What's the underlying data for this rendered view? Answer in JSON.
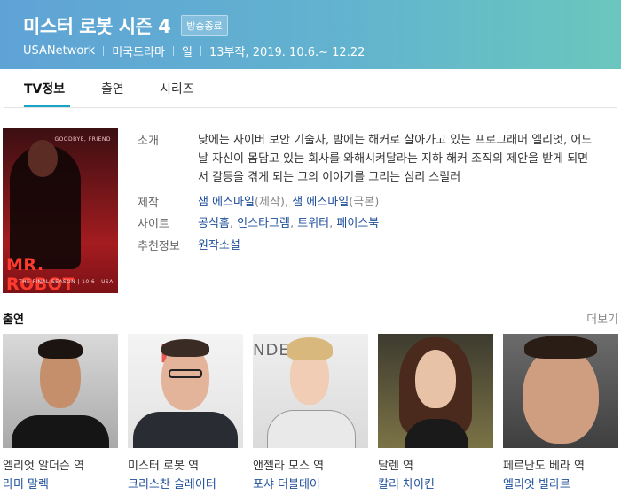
{
  "header": {
    "title": "미스터 로봇 시즌 4",
    "badge": "방송종료",
    "network": "USANetwork",
    "genre": "미국드라마",
    "day": "일",
    "episodes_period": "13부작, 2019. 10.6.~ 12.22",
    "colors": {
      "gradient_start": "#5fa3d6",
      "gradient_end": "#6ac7bd"
    }
  },
  "tabs": [
    {
      "label": "TV정보",
      "active": true
    },
    {
      "label": "출연",
      "active": false
    },
    {
      "label": "시리즈",
      "active": false
    }
  ],
  "poster": {
    "tagline": "GOODBYE, FRIEND",
    "logo_text": "MR. ROBOT",
    "season_text": "THE FINAL SEASON | 10.6 | USA"
  },
  "info": {
    "intro_label": "소개",
    "intro_text": "낮에는 사이버 보안 기술자, 밤에는 해커로 살아가고 있는 프로그래머 엘리엇, 어느 날 자신이 몸담고 있는 회사를 와해시켜달라는 지하 해커 조직의 제안을 받게 되면서 갈등을 겪게 되는 그의 이야기를 그리는 심리 스릴러",
    "production_label": "제작",
    "producer1_name": "샘 에스마일",
    "producer1_role": "(제작),",
    "producer2_name": "샘 에스마일",
    "producer2_role": "(극본)",
    "site_label": "사이트",
    "sites": [
      "공식홈",
      "인스타그램",
      "트위터",
      "페이스북"
    ],
    "recommend_label": "추천정보",
    "recommend_value": "원작소설"
  },
  "cast": {
    "title": "출연",
    "more": "더보기",
    "members": [
      {
        "role": "엘리엇 알더슨 역",
        "actor": "라미 말렉"
      },
      {
        "role": "미스터 로봇 역",
        "actor": "크리스찬 슬레이터"
      },
      {
        "role": "앤젤라 모스 역",
        "actor": "포샤 더블데이"
      },
      {
        "role": "달렌 역",
        "actor": "칼리 차이킨"
      },
      {
        "role": "페르난도 베라 역",
        "actor": "엘리엇 빌라르"
      }
    ]
  },
  "colors": {
    "link": "#1d4e9a",
    "tab_underline": "#1aa3c8"
  }
}
